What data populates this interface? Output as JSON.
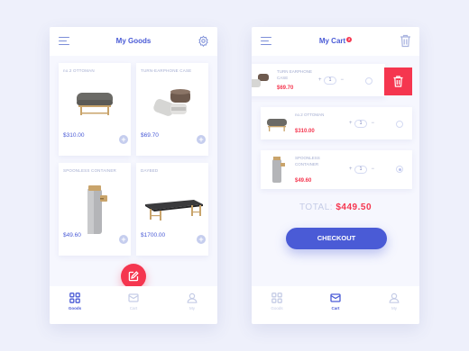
{
  "goods_screen": {
    "title": "My Goods",
    "products": [
      {
        "name": "no.2 OTTOMAN",
        "price": "$310.00",
        "image": "ottoman"
      },
      {
        "name": "TURN-EARPHONE CASE",
        "price": "$69.70",
        "image": "earphone-case"
      },
      {
        "name": "SPOONLESS CONTAINER",
        "price": "$49.60",
        "image": "container"
      },
      {
        "name": "DAYBED",
        "price": "$1700.00",
        "image": "daybed"
      }
    ],
    "fab_icon": "edit-icon"
  },
  "cart_screen": {
    "title": "My Cart",
    "badge": "2",
    "items": [
      {
        "name": "TURN EARPHONE CASE",
        "price": "$69.70",
        "qty": "1",
        "image": "earphone-case"
      },
      {
        "name": "no.2 OTTOMAN",
        "price": "$310.00",
        "qty": "1",
        "image": "ottoman"
      },
      {
        "name": "SPOONLESS CONTAINER",
        "price": "$49.60",
        "qty": "1",
        "image": "container",
        "selected": true
      }
    ],
    "total_label": "TOTAL:",
    "total_value": "$449.50",
    "checkout_label": "CHECKOUT"
  },
  "nav": {
    "goods": "Goods",
    "cart": "Cart",
    "my": "My"
  },
  "colors": {
    "accent": "#4a5bd6",
    "danger": "#f5364f",
    "background": "#eef0fb"
  }
}
